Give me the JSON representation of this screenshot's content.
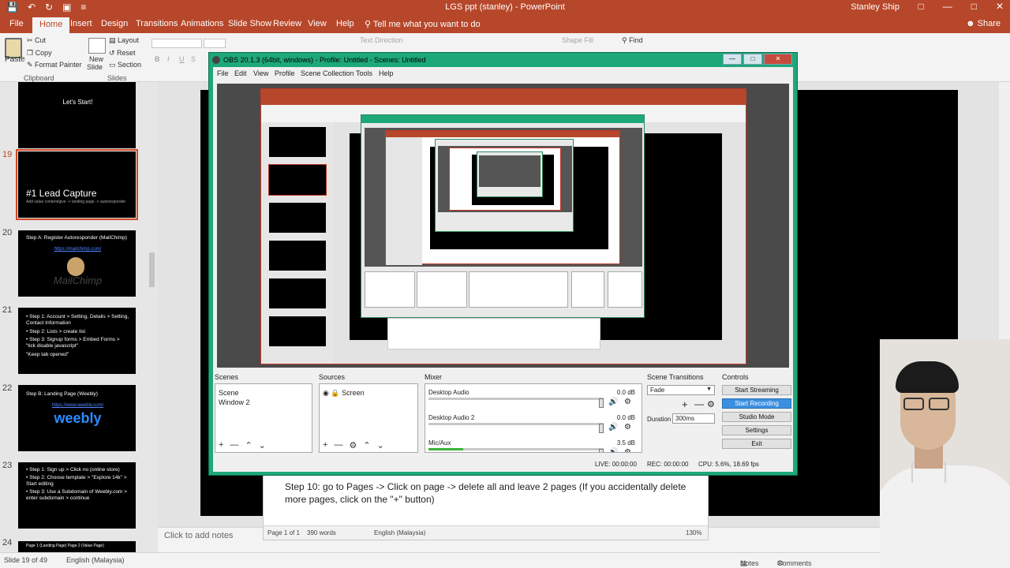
{
  "window": {
    "title": "LGS ppt (stanley) - PowerPoint",
    "user": "Stanley Ship"
  },
  "tabs": [
    "File",
    "Home",
    "Insert",
    "Design",
    "Transitions",
    "Animations",
    "Slide Show",
    "Review",
    "View",
    "Help"
  ],
  "tell_me": "Tell me what you want to do",
  "share": "Share",
  "ribbon": {
    "paste": "Paste",
    "cut": "Cut",
    "copy": "Copy",
    "format_painter": "Format Painter",
    "clipboard": "Clipboard",
    "new_slide_line1": "New",
    "new_slide_line2": "Slide",
    "layout": "Layout",
    "reset": "Reset",
    "section": "Section",
    "slides": "Slides",
    "text_direction": "Text Direction",
    "shape_fill": "Shape Fill",
    "find": "Find"
  },
  "thumbnails": [
    {
      "num": "",
      "title": "Let's Start!",
      "kind": "center"
    },
    {
      "num": "19",
      "title": "#1 Lead Capture",
      "sub": "Add value content/give -> landing page -> autoresponder",
      "kind": "lead",
      "selected": true
    },
    {
      "num": "20",
      "title": "Step A: Register Autoresponder (MailChimp)",
      "link": "https://mailchimp.com/",
      "logo": "MailChimp",
      "kind": "mail"
    },
    {
      "num": "21",
      "lines": [
        "• Step 1: Account > Setting, Details > Setting, Contact Information",
        "• Step 2: Lists > create list",
        "• Step 3: Signup forms > Embed Forms > \"tick disable javascript\"",
        "\"Keep tab opened\""
      ],
      "kind": "lines"
    },
    {
      "num": "22",
      "title": "Step B: Landing Page (Weebly)",
      "link": "https://www.weebly.com/",
      "logo": "weebly",
      "kind": "weebly"
    },
    {
      "num": "23",
      "lines": [
        "• Step 1: Sign up > Click no (online store)",
        "• Step 2: Choose template > \"Explore 14k\" > Start editing",
        "• Step 3: Use a Subdomain of Weebly.com > enter subdomain > continue"
      ],
      "kind": "lines"
    },
    {
      "num": "24",
      "lines": [
        "Page 1 (Landing Page)        Page 2 (Value Page)"
      ],
      "kind": "lines"
    }
  ],
  "notes_placeholder": "Click to add notes",
  "statusbar": {
    "slide": "Slide 19 of 49",
    "language": "English (Malaysia)",
    "notes": "Notes",
    "comments": "Comments"
  },
  "word": {
    "line1": "Step 10: go to Pages -> Click on page -> delete all and leave 2 pages (If you accidentally delete more pages, click on the \"+\" button)",
    "page": "Page 1 of 1",
    "words": "390 words",
    "language": "English (Malaysia)",
    "zoom": "130%"
  },
  "obs": {
    "title": "OBS 20.1.3 (64bit, windows) - Profile: Untitled - Scenes: Untitled",
    "menu": [
      "File",
      "Edit",
      "View",
      "Profile",
      "Scene Collection",
      "Tools",
      "Help"
    ],
    "docks": {
      "scenes": "Scenes",
      "sources": "Sources",
      "mixer": "Mixer",
      "transitions": "Scene Transitions",
      "controls": "Controls"
    },
    "scenes": [
      "Scene",
      "Window 2"
    ],
    "sources": [
      "Screen"
    ],
    "mixer": [
      {
        "name": "Desktop Audio",
        "db": "0.0 dB",
        "level": 0
      },
      {
        "name": "Desktop Audio 2",
        "db": "0.0 dB",
        "level": 0
      },
      {
        "name": "Mic/Aux",
        "db": "3.5 dB",
        "level": 0.2
      }
    ],
    "transition": "Fade",
    "duration_label": "Duration",
    "duration": "300ms",
    "controls": [
      "Start Streaming",
      "Start Recording",
      "Studio Mode",
      "Settings",
      "Exit"
    ],
    "status": {
      "live": "LIVE: 00:00:00",
      "rec": "REC: 00:00:00",
      "cpu": "CPU: 5.6%, 18.69 fps"
    }
  },
  "colors": {
    "ppt_red": "#b7472a",
    "obs_green": "#1ea87a",
    "highlight_blue": "#3c8fe0"
  }
}
